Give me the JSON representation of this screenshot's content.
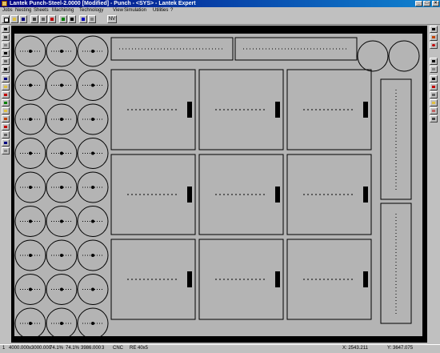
{
  "window": {
    "title": "Lantek Punch-Steel-2.0000 [Modified] - Punch - <SYS> - Lantek Expert",
    "minimize": "_",
    "maximize": "□",
    "close": "×"
  },
  "menu": [
    "Jobs",
    "Nesting",
    "Sheets",
    "Machining",
    "Technology",
    "View",
    "Simulation",
    "Utilities",
    "?"
  ],
  "toolbar": {
    "buttons": [
      "new-icon",
      "open-icon",
      "save-icon",
      "cut-icon",
      "print-icon",
      "nest-icon",
      "view-icon",
      "sheet-icon",
      "zoom-icon",
      "grid-icon"
    ],
    "tool_label": "NV"
  },
  "left_tools": [
    "select-icon",
    "sheet-icon",
    "punch-icon",
    "tool-icon",
    "part-icon",
    "dim-icon",
    "rotate-icon",
    "wizard-icon",
    "contour-icon",
    "measure-icon",
    "edit-icon",
    "cut-icon",
    "hand-icon",
    "marker-icon",
    "layer-icon",
    "part-icon"
  ],
  "right_tools": [
    "zoom-in-icon",
    "pencil-icon",
    "circle-icon",
    "move-icon",
    "window-icon",
    "repos-icon",
    "stop-icon",
    "split-icon",
    "paint-icon",
    "eraser-icon",
    "copy-icon"
  ],
  "colors": {
    "canvas": "#000000",
    "sheet": "#b4b4b4",
    "geometry": "#000000",
    "window_chrome": "#c0c0c0",
    "title_active": "#000080"
  },
  "status": {
    "page": "1",
    "sheet_size": "4000.000x3000.000",
    "util1": "74.1%",
    "util2": "74.1%",
    "weight": "3986.000",
    "count": "3",
    "mode": "CNC",
    "res": "RE 40x5",
    "x": "X: 2543.211",
    "y": "Y: 3647.075"
  }
}
